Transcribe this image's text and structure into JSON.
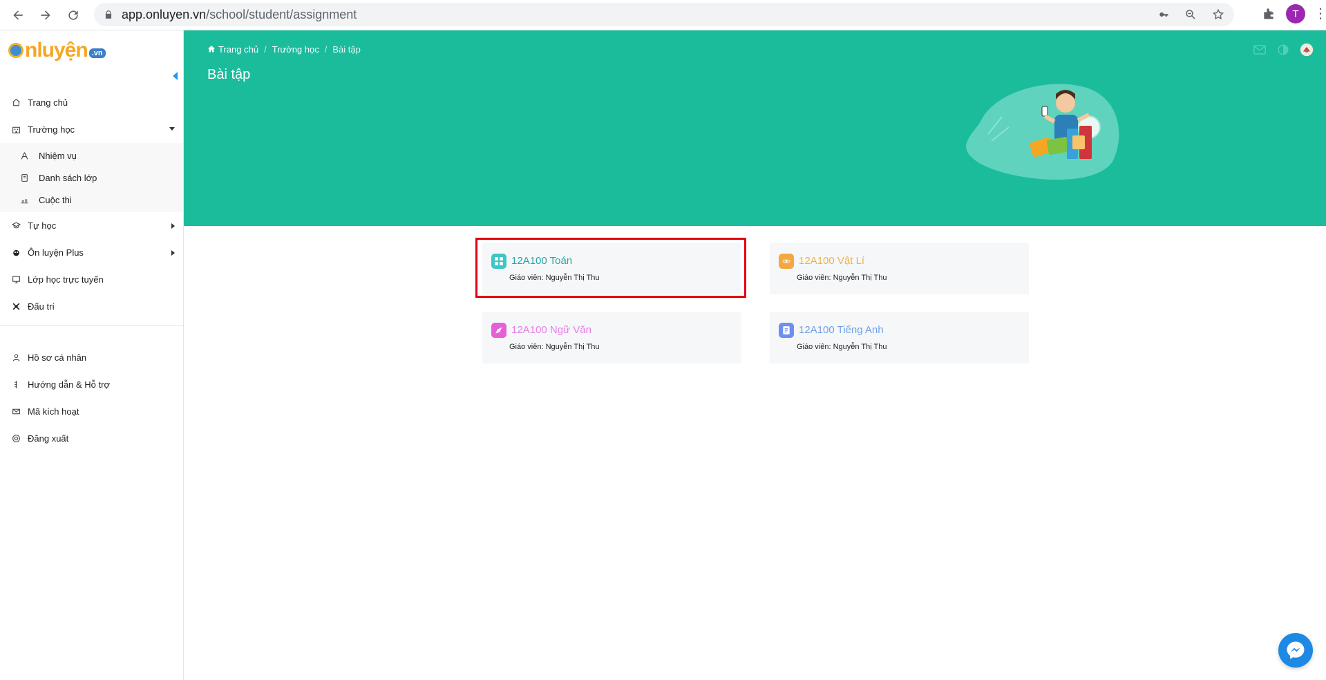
{
  "browser": {
    "url_host": "app.onluyen.vn",
    "url_path": "/school/student/assignment",
    "profile_initial": "T"
  },
  "logo": {
    "main": "nluyện",
    "suffix": ".vn"
  },
  "sidebar": {
    "items": [
      {
        "label": "Trang chủ",
        "icon": "home-icon"
      },
      {
        "label": "Trường học",
        "icon": "school-icon",
        "expanded": true,
        "children": [
          {
            "label": "Nhiệm vụ",
            "icon": "task-icon"
          },
          {
            "label": "Danh sách lớp",
            "icon": "class-list-icon"
          },
          {
            "label": "Cuộc thi",
            "icon": "contest-icon"
          }
        ]
      },
      {
        "label": "Tự học",
        "icon": "self-study-icon",
        "has_children": true
      },
      {
        "label": "Ôn luyện Plus",
        "icon": "plus-icon",
        "has_children": true
      },
      {
        "label": "Lớp học trực tuyến",
        "icon": "online-class-icon"
      },
      {
        "label": "Đấu trí",
        "icon": "battle-icon"
      }
    ],
    "bottom_items": [
      {
        "label": "Hồ sơ cá nhân",
        "icon": "profile-icon"
      },
      {
        "label": "Hướng dẫn & Hỗ trợ",
        "icon": "help-icon"
      },
      {
        "label": "Mã kích hoạt",
        "icon": "activation-code-icon"
      },
      {
        "label": "Đăng xuất",
        "icon": "logout-icon"
      }
    ]
  },
  "header": {
    "breadcrumb": [
      "Trang chủ",
      "Trường học",
      "Bài tập"
    ],
    "title": "Bài tập"
  },
  "cards": [
    {
      "title": "12A100 Toán",
      "teacher": "Giáo viên: Nguyễn Thị Thu",
      "color": "#20a8a8",
      "icon_bg": "#3ec6c6",
      "highlighted": true
    },
    {
      "title": "12A100 Vật Lí",
      "teacher": "Giáo viên: Nguyễn Thị Thu",
      "color": "#f5b041",
      "icon_bg": "#f5a742"
    },
    {
      "title": "12A100 Ngữ Văn",
      "teacher": "Giáo viên: Nguyễn Thị Thu",
      "color": "#e67de6",
      "icon_bg": "#e65fd6"
    },
    {
      "title": "12A100 Tiếng Anh",
      "teacher": "Giáo viên: Nguyễn Thị Thu",
      "color": "#6fa1e8",
      "icon_bg": "#6f8ff0"
    }
  ],
  "colors": {
    "brand": "#1abc9c",
    "highlight": "#e3000f"
  }
}
